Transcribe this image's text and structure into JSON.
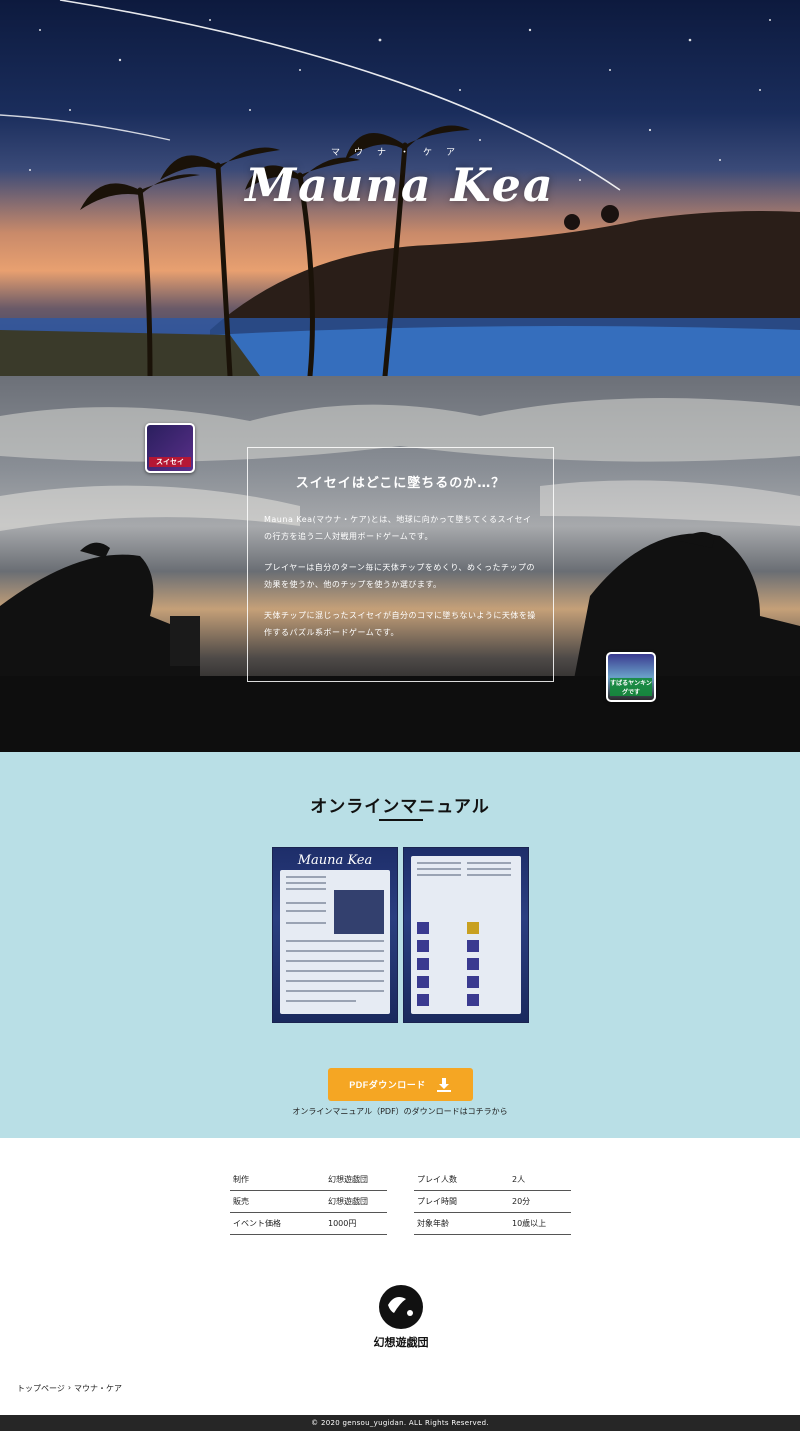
{
  "hero": {
    "title": "Mauna Kea",
    "ruby": "マウナ・ケア"
  },
  "story": {
    "heading": "スイセイはどこに墜ちるのか…？",
    "paragraphs": [
      "Mauna Kea(マウナ・ケア)とは、地球に向かって墜ちてくるスイセイの行方を追う二人対戦用ボードゲームです。",
      "プレイヤーは自分のターン毎に天体チップをめくり、めくったチップの効果を使うか、他のチップを使うか選びます。",
      "天体チップに混じったスイセイが自分のコマに墜ちないように天体を操作するパズル系ボードゲームです。"
    ],
    "sticker_left": "スイセイ",
    "sticker_right": "すばるヤンキングです"
  },
  "manual": {
    "title": "オンラインマニュアル",
    "page_logo": "Mauna Kea",
    "button_label": "PDFダウンロード",
    "note": "オンラインマニュアル（PDF）のダウンロードはコチラから"
  },
  "specs": {
    "left": [
      {
        "key": "制作",
        "value": "幻想遊戯団"
      },
      {
        "key": "販売",
        "value": "幻想遊戯団"
      },
      {
        "key": "イベント価格",
        "value": "1000円"
      }
    ],
    "right": [
      {
        "key": "プレイ人数",
        "value": "2人"
      },
      {
        "key": "プレイ時間",
        "value": "20分"
      },
      {
        "key": "対象年齢",
        "value": "10歳以上"
      }
    ]
  },
  "brand": {
    "logo_text": "幻想遊戯団"
  },
  "breadcrumb": {
    "home": "トップページ",
    "current": "マウナ・ケア"
  },
  "footer": {
    "copyright": "© 2020 gensou_yugidan. ALL Rights Reserved."
  },
  "colors": {
    "manual_bg": "#b9dfe6",
    "button": "#f5a623",
    "footer_bg": "#262626"
  }
}
